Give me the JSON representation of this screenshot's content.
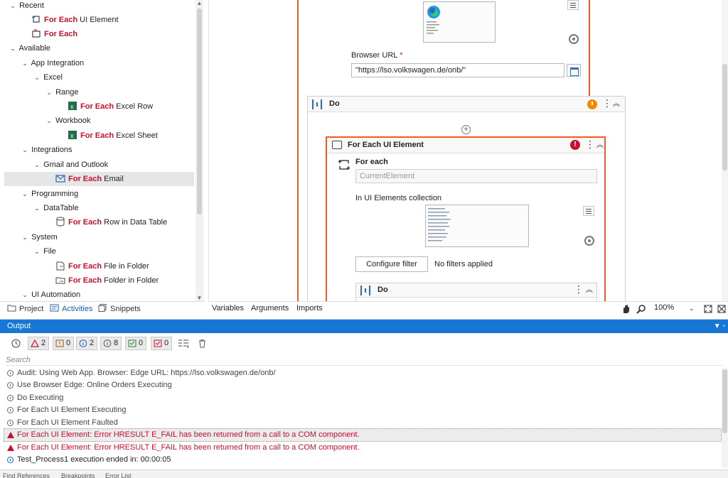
{
  "activities_tree": {
    "rows": [
      {
        "label": "Recent",
        "hl": "",
        "rest": "Recent"
      },
      {
        "label": "For Each UI Element",
        "hl": "For Each",
        "rest": " UI Element"
      },
      {
        "label": "For Each",
        "hl": "For Each",
        "rest": ""
      },
      {
        "label": "Available",
        "hl": "",
        "rest": "Available"
      },
      {
        "label": "App Integration",
        "hl": "",
        "rest": "App Integration"
      },
      {
        "label": "Excel",
        "hl": "",
        "rest": "Excel"
      },
      {
        "label": "Range",
        "hl": "",
        "rest": "Range"
      },
      {
        "label": "For Each Excel Row",
        "hl": "For Each",
        "rest": " Excel Row"
      },
      {
        "label": "Workbook",
        "hl": "",
        "rest": "Workbook"
      },
      {
        "label": "For Each Excel Sheet",
        "hl": "For Each",
        "rest": " Excel Sheet"
      },
      {
        "label": "Integrations",
        "hl": "",
        "rest": "Integrations"
      },
      {
        "label": "Gmail and Outlook",
        "hl": "",
        "rest": "Gmail and Outlook"
      },
      {
        "label": "For Each Email",
        "hl": "For Each",
        "rest": " Email"
      },
      {
        "label": "Programming",
        "hl": "",
        "rest": "Programming"
      },
      {
        "label": "DataTable",
        "hl": "",
        "rest": "DataTable"
      },
      {
        "label": "For Each Row in Data Table",
        "hl": "For Each",
        "rest": " Row in Data Table"
      },
      {
        "label": "System",
        "hl": "",
        "rest": "System"
      },
      {
        "label": "File",
        "hl": "",
        "rest": "File"
      },
      {
        "label": "For Each File in Folder",
        "hl": "For Each",
        "rest": " File in Folder"
      },
      {
        "label": "For Each Folder in Folder",
        "hl": "For Each",
        "rest": " Folder in Folder"
      },
      {
        "label": "UI Automation",
        "hl": "",
        "rest": "UI Automation"
      }
    ]
  },
  "left_tabs": {
    "project": "Project",
    "activities": "Activities",
    "snippets": "Snippets"
  },
  "designer": {
    "browser_url_label": "Browser URL",
    "required_mark": "*",
    "browser_url_value": "\"https://lso.volkswagen.de/onb/\"",
    "do_title": "Do",
    "for_each_ui_title": "For Each UI Element",
    "for_each_label": "For each",
    "current_element_placeholder": "CurrentElement",
    "collection_label": "In UI Elements collection",
    "configure_filter": "Configure filter",
    "no_filters": "No filters applied",
    "inner_do_title": "Do",
    "error_badge": "!"
  },
  "designer_tabs": {
    "variables": "Variables",
    "arguments": "Arguments",
    "imports": "Imports",
    "zoom": "100%"
  },
  "output": {
    "title": "Output",
    "pin": "▼ ▫",
    "filters": {
      "errors": "2",
      "warnings": "0",
      "info": "2",
      "trace": "8",
      "verbose": "0",
      "critical": "0"
    },
    "search_placeholder": "Search",
    "logs": [
      {
        "text": "Audit: Using Web App. Browser: Edge URL: https://lso.volkswagen.de/onb/",
        "kind": "trace"
      },
      {
        "text": "Use Browser Edge: Online Orders Executing",
        "kind": "trace"
      },
      {
        "text": "Do Executing",
        "kind": "trace"
      },
      {
        "text": "For Each UI Element Executing",
        "kind": "trace"
      },
      {
        "text": "For Each UI Element Faulted",
        "kind": "trace"
      },
      {
        "text": "For Each UI Element: Error HRESULT E_FAIL has been returned from a call to a COM component.",
        "kind": "error"
      },
      {
        "text": "For Each UI Element: Error HRESULT E_FAIL has been returned from a call to a COM component.",
        "kind": "error"
      },
      {
        "text": "Test_Process1 execution ended in: 00:00:05",
        "kind": "info"
      }
    ],
    "status_strip": [
      "Find References",
      "Breakpoints",
      "Error List"
    ]
  },
  "colors": {
    "accent": "#1877d4",
    "highlight": "#c8102e",
    "activity_border": "#f15a24",
    "warning": "#ef8a00"
  }
}
